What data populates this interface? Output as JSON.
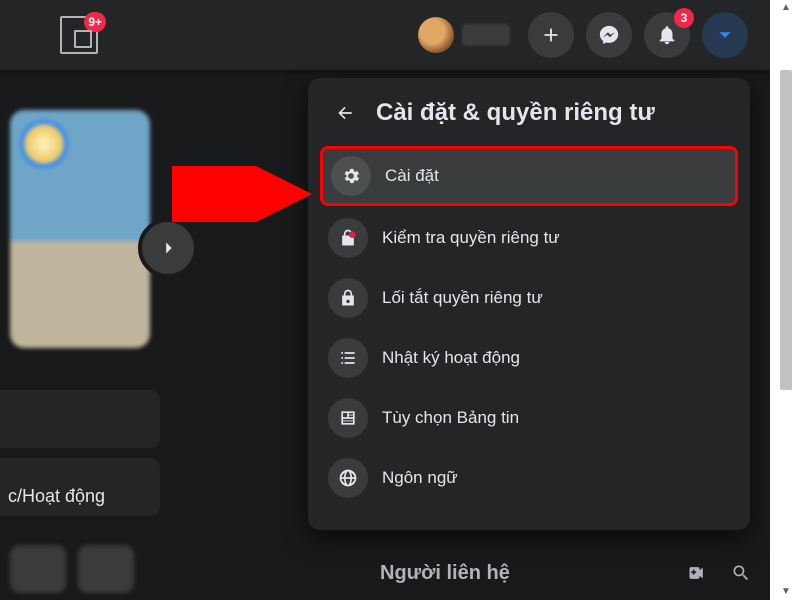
{
  "topbar": {
    "tab_badge": "9+",
    "notif_badge": "3"
  },
  "panel": {
    "title": "Cài đặt & quyền riêng tư",
    "items": [
      {
        "label": "Cài đặt",
        "icon": "gear"
      },
      {
        "label": "Kiểm tra quyền riêng tư",
        "icon": "lock-heart"
      },
      {
        "label": "Lối tắt quyền riêng tư",
        "icon": "lock"
      },
      {
        "label": "Nhật ký hoạt động",
        "icon": "list"
      },
      {
        "label": "Tùy chọn Bảng tin",
        "icon": "feed"
      },
      {
        "label": "Ngôn ngữ",
        "icon": "globe"
      }
    ]
  },
  "contacts": {
    "label": "Người liên hệ"
  },
  "left": {
    "tab_label": "c/Hoạt động"
  },
  "highlight_index": 0
}
